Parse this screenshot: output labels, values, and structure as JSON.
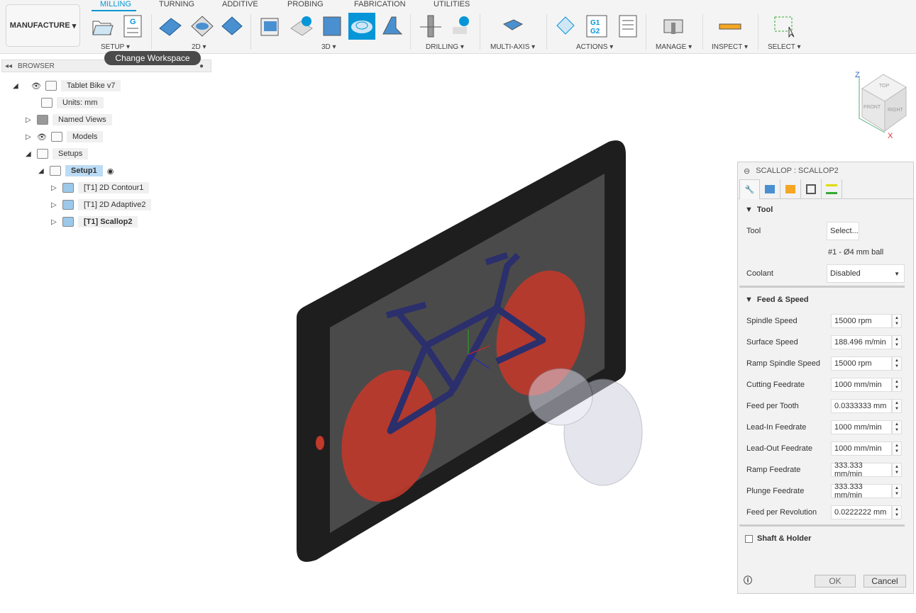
{
  "workspace": {
    "label": "MANUFACTURE",
    "tooltip": "Change Workspace"
  },
  "tabs": [
    "MILLING",
    "TURNING",
    "ADDITIVE",
    "PROBING",
    "FABRICATION",
    "UTILITIES"
  ],
  "groups": [
    "SETUP ▾",
    "2D ▾",
    "3D ▾",
    "DRILLING ▾",
    "MULTI-AXIS ▾",
    "ACTIONS ▾",
    "MANAGE ▾",
    "INSPECT ▾",
    "SELECT ▾"
  ],
  "browser": {
    "title": "BROWSER",
    "root": "Tablet Bike v7",
    "units": "Units: mm",
    "named_views": "Named Views",
    "models": "Models",
    "setups": "Setups",
    "setup1": "Setup1",
    "ops": [
      "[T1] 2D Contour1",
      "[T1] 2D Adaptive2",
      "[T1] Scallop2"
    ]
  },
  "viewcube": {
    "top": "TOP",
    "front": "FRONT",
    "right": "RIGHT",
    "z": "Z",
    "x": "X"
  },
  "panel": {
    "title": "SCALLOP : SCALLOP2",
    "tool_section": "Tool",
    "tool_label": "Tool",
    "tool_button": "Select...",
    "tool_desc": "#1 - Ø4 mm ball",
    "coolant_label": "Coolant",
    "coolant_value": "Disabled",
    "feed_section": "Feed & Speed",
    "fields": [
      {
        "label": "Spindle Speed",
        "value": "15000 rpm"
      },
      {
        "label": "Surface Speed",
        "value": "188.496 m/min"
      },
      {
        "label": "Ramp Spindle Speed",
        "value": "15000 rpm"
      },
      {
        "label": "Cutting Feedrate",
        "value": "1000 mm/min"
      },
      {
        "label": "Feed per Tooth",
        "value": "0.0333333 mm"
      },
      {
        "label": "Lead-In Feedrate",
        "value": "1000 mm/min"
      },
      {
        "label": "Lead-Out Feedrate",
        "value": "1000 mm/min"
      },
      {
        "label": "Ramp Feedrate",
        "value": "333.333 mm/min"
      },
      {
        "label": "Plunge Feedrate",
        "value": "333.333 mm/min"
      },
      {
        "label": "Feed per Revolution",
        "value": "0.0222222 mm"
      }
    ],
    "shaft_section": "Shaft & Holder",
    "ok": "OK",
    "cancel": "Cancel"
  },
  "colors": {
    "accent": "#0696d7",
    "wheel": "#c0392b",
    "frame": "#2b2f6b"
  }
}
